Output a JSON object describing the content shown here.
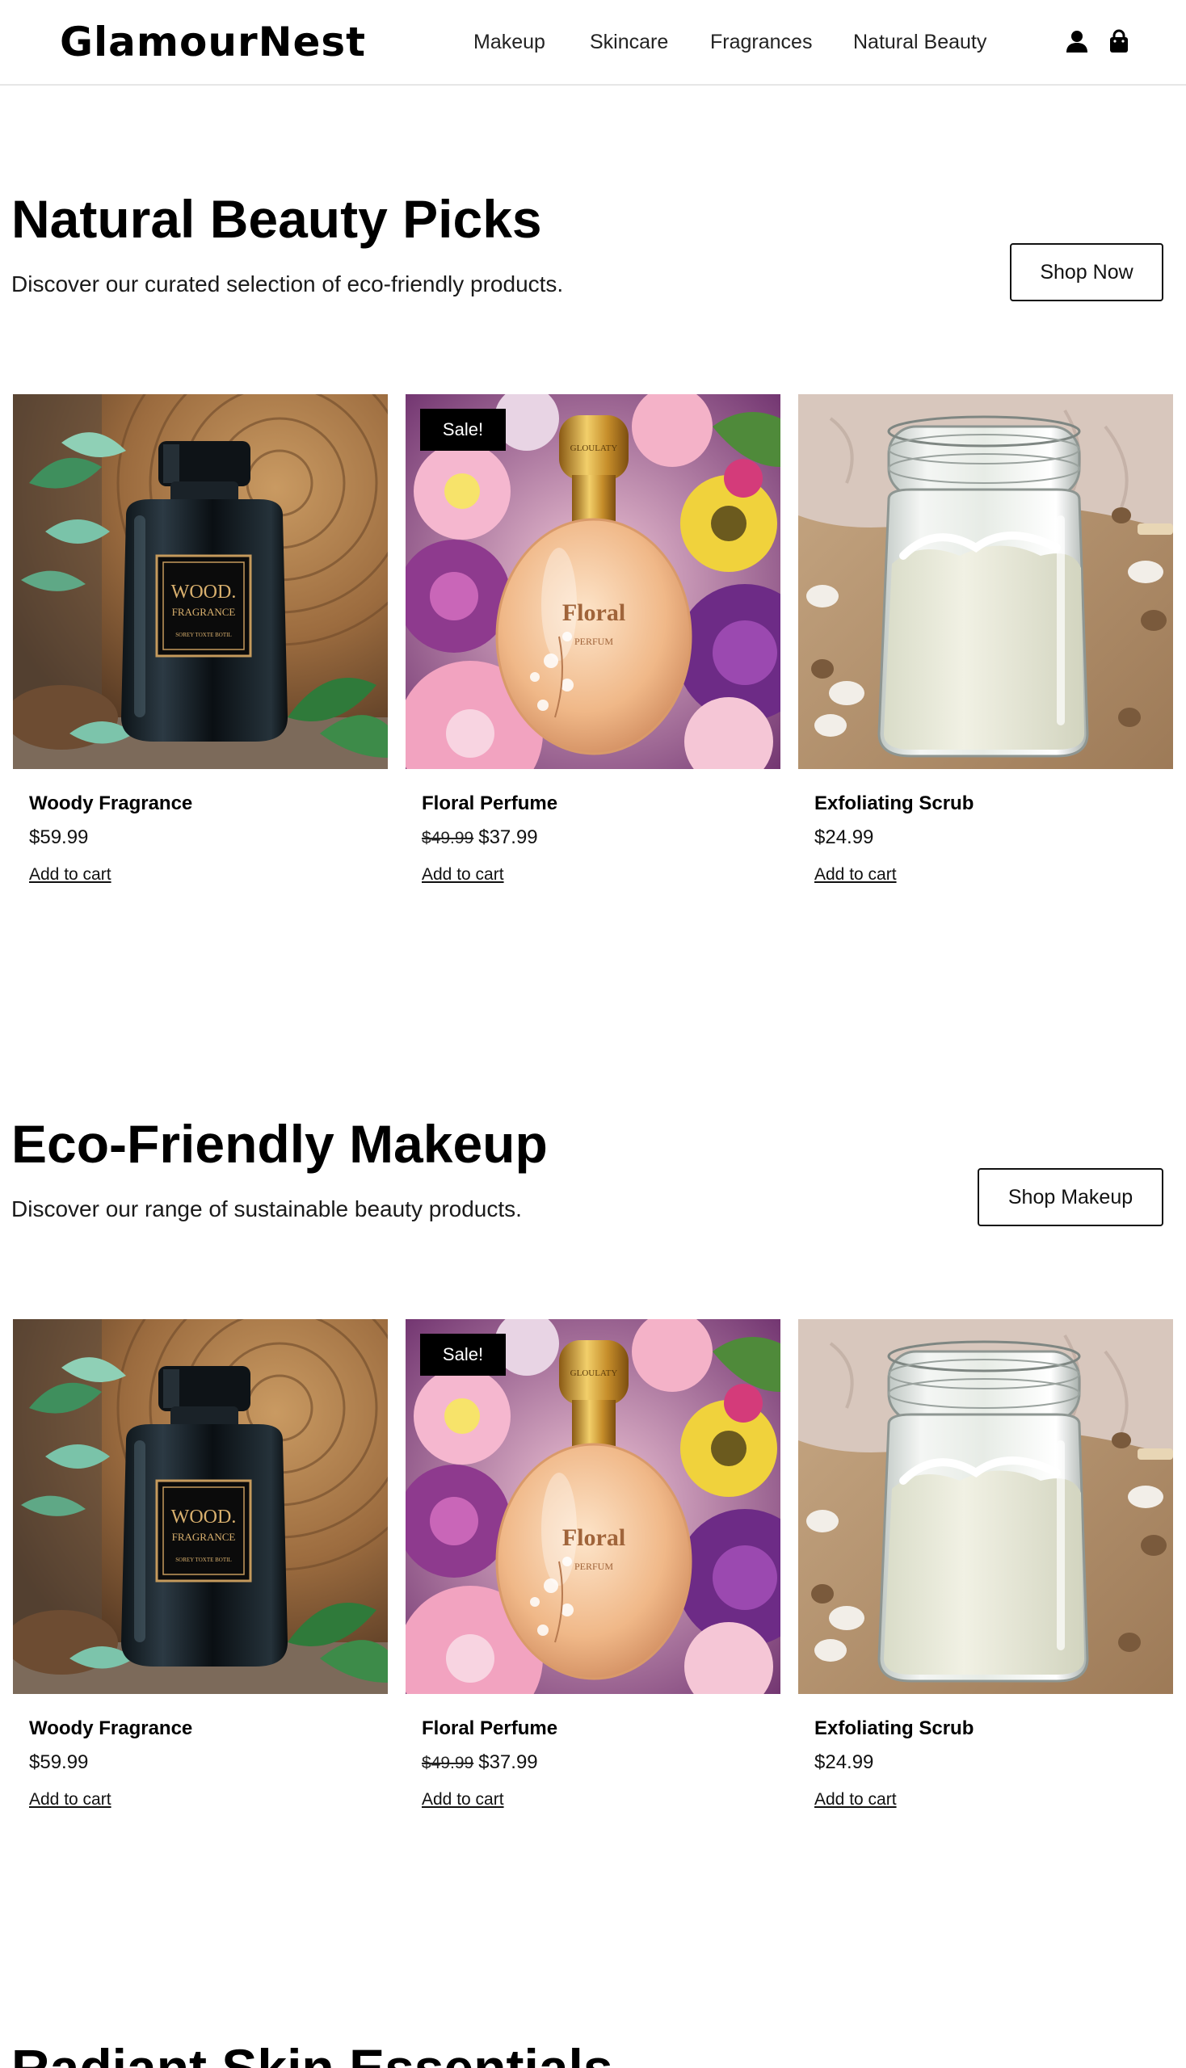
{
  "brand": {
    "name": "GlamourNest"
  },
  "nav": {
    "items": [
      {
        "label": "Makeup"
      },
      {
        "label": "Skincare"
      },
      {
        "label": "Fragrances"
      },
      {
        "label": "Natural Beauty"
      }
    ],
    "account_icon": "user-icon",
    "cart_icon": "shopping-bag-icon"
  },
  "sections": [
    {
      "title": "Natural Beauty Picks",
      "subtitle": "Discover our curated selection of eco-friendly products.",
      "cta_label": "Shop Now",
      "products": [
        {
          "name": "Woody Fragrance",
          "price": "$59.99",
          "old_price": "",
          "add_label": "Add to cart",
          "badge": "",
          "image": "wood-fragrance-bottle-image",
          "label_main": "WOOD.",
          "label_sub": "FRAGRANCE",
          "label_tiny": "SOREY TOXTE BOTIL"
        },
        {
          "name": "Floral Perfume",
          "price": "$37.99",
          "old_price": "$49.99",
          "add_label": "Add to cart",
          "badge": "Sale!",
          "image": "floral-perfume-bottle-image",
          "label_main": "Floral",
          "label_sub": "PERFUM",
          "label_tiny": "GLOULATY"
        },
        {
          "name": "Exfoliating Scrub",
          "price": "$24.99",
          "old_price": "",
          "add_label": "Add to cart",
          "badge": "",
          "image": "scrub-jar-image"
        }
      ]
    },
    {
      "title": "Eco-Friendly Makeup",
      "subtitle": "Discover our range of sustainable beauty products.",
      "cta_label": "Shop Makeup",
      "products": [
        {
          "name": "Woody Fragrance",
          "price": "$59.99",
          "old_price": "",
          "add_label": "Add to cart",
          "badge": "",
          "image": "wood-fragrance-bottle-image",
          "label_main": "WOOD.",
          "label_sub": "FRAGRANCE",
          "label_tiny": "SOREY TOXTE BOTIL"
        },
        {
          "name": "Floral Perfume",
          "price": "$37.99",
          "old_price": "$49.99",
          "add_label": "Add to cart",
          "badge": "Sale!",
          "image": "floral-perfume-bottle-image",
          "label_main": "Floral",
          "label_sub": "PERFUM",
          "label_tiny": "GLOULATY"
        },
        {
          "name": "Exfoliating Scrub",
          "price": "$24.99",
          "old_price": "",
          "add_label": "Add to cart",
          "badge": "",
          "image": "scrub-jar-image"
        }
      ]
    },
    {
      "title": "Radiant Skin Essentials"
    }
  ],
  "colors": {
    "text": "#000000",
    "badge_bg": "#000000",
    "badge_text": "#ffffff",
    "border": "#e6e6e6"
  }
}
